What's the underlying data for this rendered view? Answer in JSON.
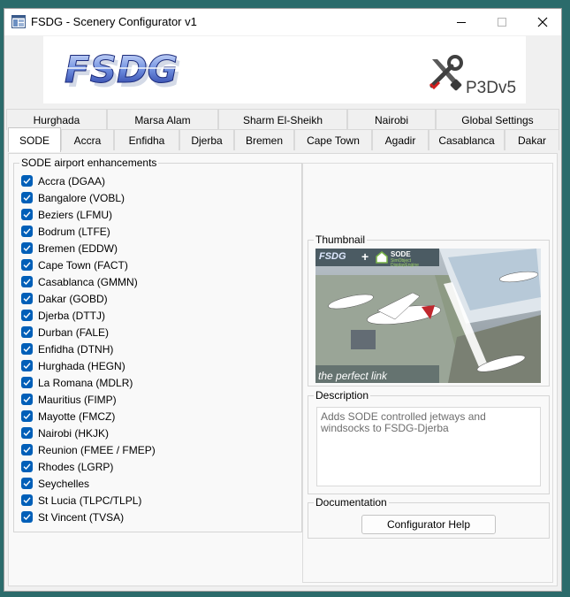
{
  "window": {
    "title": "FSDG - Scenery Configurator v1",
    "controls": [
      "minimize",
      "maximize",
      "close"
    ]
  },
  "banner": {
    "logo_text": "FSDG",
    "platform": "P3Dv5"
  },
  "tabs_row1": [
    "Hurghada",
    "Marsa Alam",
    "Sharm El-Sheikh",
    "Nairobi",
    "Global Settings"
  ],
  "tabs_row2": [
    "SODE",
    "Accra",
    "Enfidha",
    "Djerba",
    "Bremen",
    "Cape Town",
    "Agadir",
    "Casablanca",
    "Dakar"
  ],
  "active_tab": "SODE",
  "sode": {
    "group_title": "SODE airport enhancements",
    "airports": [
      {
        "label": "Accra (DGAA)",
        "checked": true
      },
      {
        "label": "Bangalore (VOBL)",
        "checked": true
      },
      {
        "label": "Beziers (LFMU)",
        "checked": true
      },
      {
        "label": "Bodrum (LTFE)",
        "checked": true
      },
      {
        "label": "Bremen (EDDW)",
        "checked": true
      },
      {
        "label": "Cape Town (FACT)",
        "checked": true
      },
      {
        "label": "Casablanca (GMMN)",
        "checked": true
      },
      {
        "label": "Dakar (GOBD)",
        "checked": true
      },
      {
        "label": "Djerba (DTTJ)",
        "checked": true
      },
      {
        "label": "Durban (FALE)",
        "checked": true
      },
      {
        "label": "Enfidha (DTNH)",
        "checked": true
      },
      {
        "label": "Hurghada (HEGN)",
        "checked": true
      },
      {
        "label": "La Romana (MDLR)",
        "checked": true
      },
      {
        "label": "Mauritius (FIMP)",
        "checked": true
      },
      {
        "label": "Mayotte (FMCZ)",
        "checked": true
      },
      {
        "label": "Nairobi (HKJK)",
        "checked": true
      },
      {
        "label": "Reunion (FMEE / FMEP)",
        "checked": true
      },
      {
        "label": "Rhodes (LGRP)",
        "checked": true
      },
      {
        "label": "Seychelles",
        "checked": true
      },
      {
        "label": "St Lucia (TLPC/TLPL)",
        "checked": true
      },
      {
        "label": "St Vincent (TVSA)",
        "checked": true
      }
    ]
  },
  "thumbnail": {
    "title": "Thumbnail",
    "caption": "the perfect link",
    "brand_left": "FSDG",
    "brand_right": "SODE",
    "brand_right_sub1": "SimObject",
    "brand_right_sub2": "DisplayEngine"
  },
  "description": {
    "title": "Description",
    "text": "Adds SODE controlled jetways and windsocks to FSDG-Djerba"
  },
  "documentation": {
    "title": "Documentation",
    "button_label": "Configurator Help"
  },
  "colors": {
    "accent": "#005fb8",
    "desktop": "#2b6b6b"
  }
}
